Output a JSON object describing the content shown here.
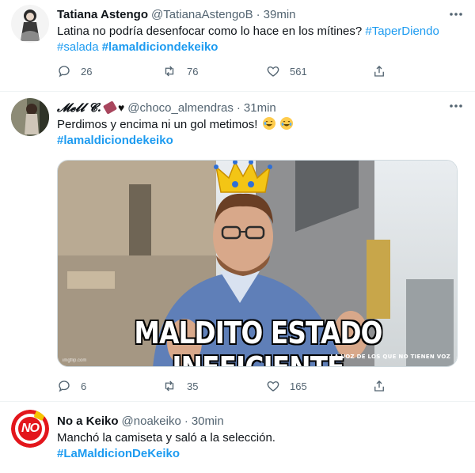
{
  "tweets": [
    {
      "name": "Tatiana Astengo",
      "handle": "@TatianaAstengoB",
      "time": "39min",
      "text": "Latina no podría desenfocar como lo hace en los mítines?",
      "hashtags": [
        "#TaperDiendo",
        "#salada",
        "#lamaldiciondekeiko"
      ],
      "replies": "26",
      "retweets": "76",
      "likes": "561"
    },
    {
      "name": "𝓜𝓮𝓵𝓵 𝓒.",
      "handle": "@choco_almendras",
      "time": "31min",
      "text": "Perdimos y encima ni un gol metimos!",
      "hashtags": [
        "#lamaldiciondekeiko"
      ],
      "media_caption": "MALDITO ESTADO INEFICIENTE",
      "media_watermark": "LA VOZ DE LOS QUE NO TIENEN VOZ",
      "media_credit": "imgflip.com",
      "replies": "6",
      "retweets": "35",
      "likes": "165"
    },
    {
      "name": "No a Keiko",
      "handle": "@noakeiko",
      "time": "30min",
      "text": "Manchó la camiseta y saló a la selección.",
      "hashtags": [
        "#LaMaldicionDeKeiko"
      ],
      "avatar_text": "NO"
    }
  ],
  "separator": "·",
  "icons": {
    "reply": "reply-icon",
    "retweet": "retweet-icon",
    "like": "heart-icon",
    "share": "share-icon",
    "more": "more-icon"
  },
  "colors": {
    "link": "#1d9bf0",
    "muted": "#536471",
    "no_keiko_red": "#e3161c"
  }
}
